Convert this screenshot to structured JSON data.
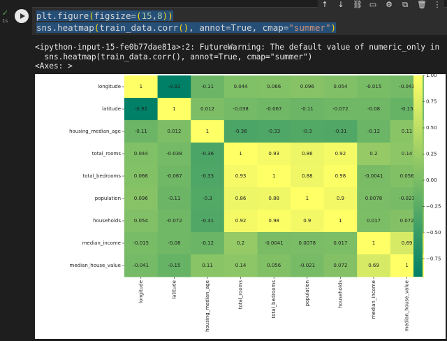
{
  "cell": {
    "exec_check": "✓",
    "exec_time": "1s",
    "code_line1": "plt.figure(figsize=(15,8))",
    "code_line2": "sns.heatmap(train_data.corr(), annot=True, cmap=\"summer\")"
  },
  "toolbar": {
    "icons": [
      "arrow-up-icon",
      "arrow-down-icon",
      "link-icon",
      "comment-icon",
      "gear-icon",
      "mirror-icon",
      "delete-icon",
      "more-icon"
    ],
    "glyphs": [
      "↑",
      "↓",
      "⛓",
      "▭",
      "⚙",
      "⧉",
      "🗑",
      "⋮"
    ]
  },
  "output": {
    "warning_line1": "<ipython-input-15-fe0b77dae81a>:2: FutureWarning: The default value of numeric_only in",
    "warning_line2": "  sns.heatmap(train_data.corr(), annot=True, cmap=\"summer\")",
    "axes_repr": "<Axes: >"
  },
  "chart_data": {
    "type": "heatmap",
    "colormap": "summer",
    "labels": [
      "longitude",
      "latitude",
      "housing_median_age",
      "total_rooms",
      "total_bedrooms",
      "population",
      "households",
      "median_income",
      "median_house_value"
    ],
    "values": [
      [
        1,
        -0.92,
        -0.11,
        0.044,
        0.066,
        0.096,
        0.054,
        -0.015,
        -0.041
      ],
      [
        -0.92,
        1,
        0.012,
        -0.038,
        -0.067,
        -0.11,
        -0.072,
        -0.08,
        -0.15
      ],
      [
        -0.11,
        0.012,
        1,
        -0.36,
        -0.33,
        -0.3,
        -0.31,
        -0.12,
        0.11
      ],
      [
        0.044,
        -0.038,
        -0.36,
        1,
        0.93,
        0.86,
        0.92,
        0.2,
        0.14
      ],
      [
        0.066,
        -0.067,
        -0.33,
        0.93,
        1,
        0.88,
        0.98,
        -0.0041,
        0.056
      ],
      [
        0.096,
        -0.11,
        -0.3,
        0.86,
        0.88,
        1,
        0.9,
        0.0078,
        -0.021
      ],
      [
        0.054,
        -0.072,
        -0.31,
        0.92,
        0.98,
        0.9,
        1,
        0.017,
        0.072
      ],
      [
        -0.015,
        -0.08,
        -0.12,
        0.2,
        -0.0041,
        0.0078,
        0.017,
        1,
        0.69
      ],
      [
        -0.041,
        -0.15,
        0.11,
        0.14,
        0.056,
        -0.021,
        0.072,
        0.69,
        1
      ]
    ],
    "colorbar_ticks": [
      "1.00",
      "0.75",
      "0.50",
      "0.25",
      "0.00",
      "−0.25",
      "−0.50",
      "−0.75"
    ],
    "colorbar_tick_values": [
      1.0,
      0.75,
      0.5,
      0.25,
      0.0,
      -0.25,
      -0.5,
      -0.75
    ],
    "vmin": -0.92,
    "vmax": 1.0
  }
}
